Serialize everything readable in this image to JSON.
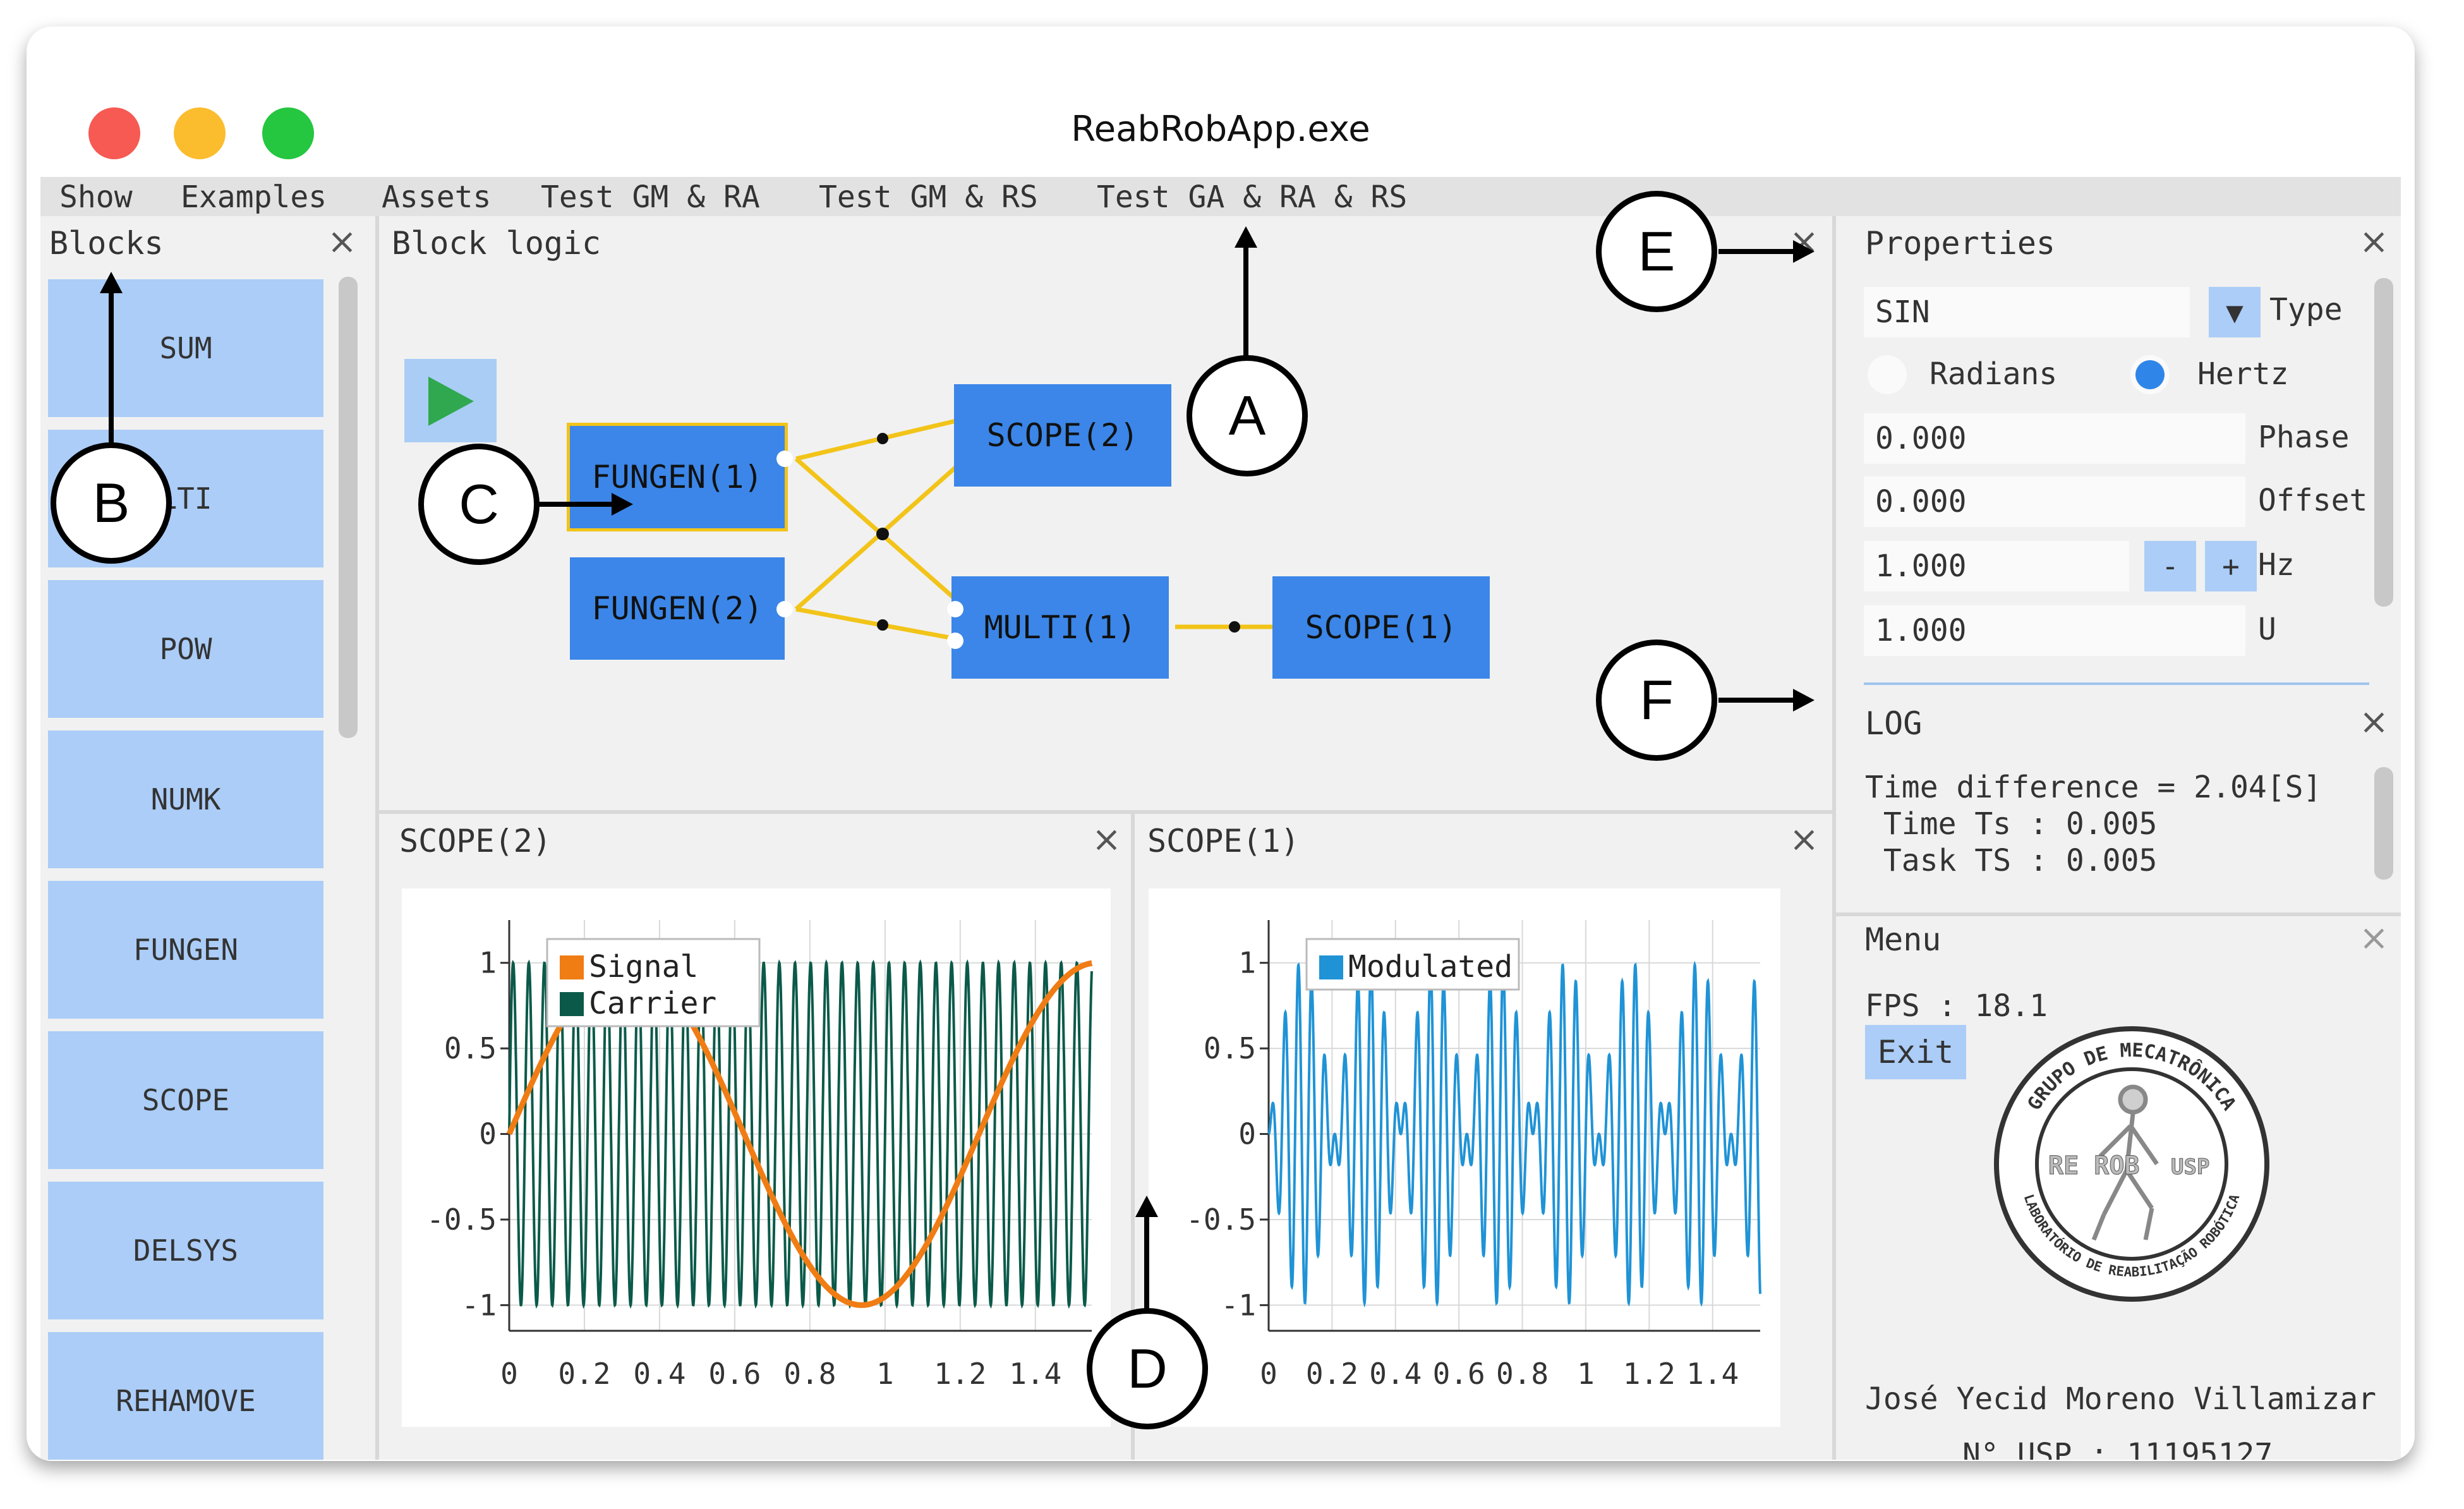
{
  "window": {
    "title": "ReabRobApp.exe"
  },
  "menu": [
    "Show",
    "Examples",
    "Assets",
    "Test GM & RA",
    "Test GM & RS",
    "Test GA & RA & RS"
  ],
  "blocks_panel": {
    "title": "Blocks",
    "items": [
      "SUM",
      "LTI",
      "POW",
      "NUMK",
      "FUNGEN",
      "SCOPE",
      "DELSYS",
      "REHAMOVE"
    ]
  },
  "block_logic": {
    "title": "Block logic",
    "nodes": [
      "FUNGEN(1)",
      "FUNGEN(2)",
      "SCOPE(2)",
      "MULTI(1)",
      "SCOPE(1)"
    ]
  },
  "properties": {
    "title": "Properties",
    "type_value": "SIN",
    "type_label": "Type",
    "radio_radians": "Radians",
    "radio_hertz": "Hertz",
    "selected_unit": "Hertz",
    "phase_value": "0.000",
    "phase_label": "Phase",
    "offset_value": "0.000",
    "offset_label": "Offset",
    "hz_value": "1.000",
    "hz_label": "Hz",
    "minus_label": "-",
    "plus_label": "+",
    "u_value": "1.000",
    "u_label": "U"
  },
  "log": {
    "title": "LOG",
    "lines": [
      "Time difference = 2.04[S]",
      " Time Ts : 0.005",
      " Task TS : 0.005"
    ]
  },
  "menu_panel": {
    "title": "Menu",
    "fps": "FPS : 18.1",
    "exit": "Exit",
    "author": "José Yecid Moreno Villamizar",
    "usp": "N° USP : 11195127",
    "logo_text": [
      "GRUPO DE MECATRÔNICA",
      "LABORATÓRIO DE REABILITAÇÃO ROBÓTICA",
      "RE ROB",
      "USP"
    ]
  },
  "annotations": [
    "A",
    "B",
    "C",
    "D",
    "E",
    "F"
  ],
  "chart_data": [
    {
      "type": "line",
      "panel_title": "SCOPE(2)",
      "x_ticks": [
        "0",
        "0.2",
        "0.4",
        "0.6",
        "0.8",
        "1",
        "1.2",
        "1.4"
      ],
      "y_ticks": [
        "1",
        "0.5",
        "0",
        "-0.5",
        "-1"
      ],
      "xlim": [
        0,
        1.55
      ],
      "ylim": [
        -1.15,
        1.25
      ],
      "grid": true,
      "legend_position": "top-left",
      "series": [
        {
          "name": "Signal",
          "color": "#f07c14",
          "function": "sin",
          "frequency_hz": 0.8,
          "amplitude": 1
        },
        {
          "name": "Carrier",
          "color": "#0b5a49",
          "function": "sin",
          "frequency_hz": 24,
          "amplitude": 1
        }
      ]
    },
    {
      "type": "line",
      "panel_title": "SCOPE(1)",
      "x_ticks": [
        "0",
        "0.2",
        "0.4",
        "0.6",
        "0.8",
        "1",
        "1.2",
        "1.4"
      ],
      "y_ticks": [
        "1",
        "0.5",
        "0",
        "-0.5",
        "-1"
      ],
      "xlim": [
        0,
        1.55
      ],
      "ylim": [
        -1.15,
        1.25
      ],
      "grid": true,
      "legend_position": "top-left",
      "series": [
        {
          "name": "Modulated",
          "color": "#1f93d6",
          "function": "sin*sin",
          "envelope_frequency_hz": 2.4,
          "carrier_frequency_hz": 24,
          "amplitude": 1
        }
      ]
    }
  ],
  "colors": {
    "node_blue": "#3b86e8",
    "block_light_blue": "#abcdf7",
    "wire_yellow": "#f2c419",
    "signal_orange": "#f07c14",
    "carrier_green": "#0b5a49",
    "modulated_blue": "#1f93d6",
    "run_green": "#2fa84f"
  }
}
